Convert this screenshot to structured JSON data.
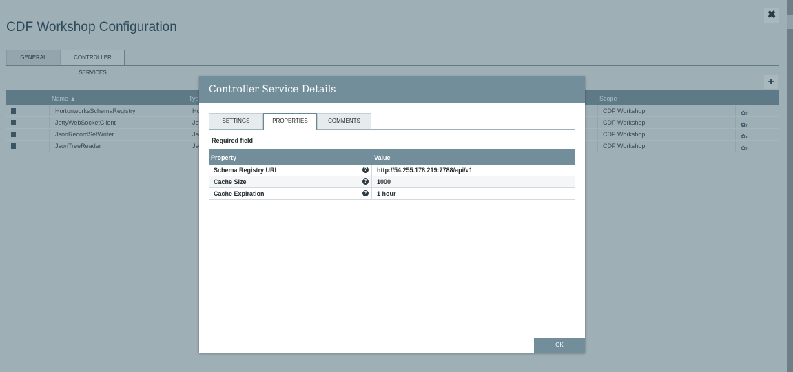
{
  "background": {
    "title": "CDF Workshop Configuration",
    "close_glyph": "✖",
    "tabs": [
      {
        "label": "GENERAL"
      },
      {
        "label": "CONTROLLER SERVICES"
      }
    ],
    "add_glyph": "+",
    "table": {
      "headers": {
        "name": "Name ▲",
        "type": "Typ",
        "scope": "Scope"
      },
      "rows": [
        {
          "name": "HortonworksSchemaRegistry",
          "type": "Ho",
          "scope": "CDF Workshop"
        },
        {
          "name": "JettyWebSocketClient",
          "type": "Jet",
          "scope": "CDF Workshop"
        },
        {
          "name": "JsonRecordSetWriter",
          "type": "Jso",
          "scope": "CDF Workshop"
        },
        {
          "name": "JsonTreeReader",
          "type": "Jso",
          "scope": "CDF Workshop"
        }
      ],
      "action_icons": [
        "gear-icon",
        "bolt-icon"
      ]
    }
  },
  "dialog": {
    "title": "Controller Service Details",
    "tabs": [
      {
        "label": "SETTINGS"
      },
      {
        "label": "PROPERTIES",
        "active": true
      },
      {
        "label": "COMMENTS"
      }
    ],
    "required_label": "Required field",
    "table": {
      "headers": {
        "property": "Property",
        "value": "Value"
      },
      "rows": [
        {
          "property": "Schema Registry URL",
          "value": "http://54.255.178.219:7788/api/v1"
        },
        {
          "property": "Cache Size",
          "value": "1000"
        },
        {
          "property": "Cache Expiration",
          "value": "1 hour"
        }
      ]
    },
    "ok_label": "OK"
  },
  "colors": {
    "accent": "#728e9b",
    "header_dark": "#5f7a87",
    "overlay_bg": "#9fafb6"
  }
}
